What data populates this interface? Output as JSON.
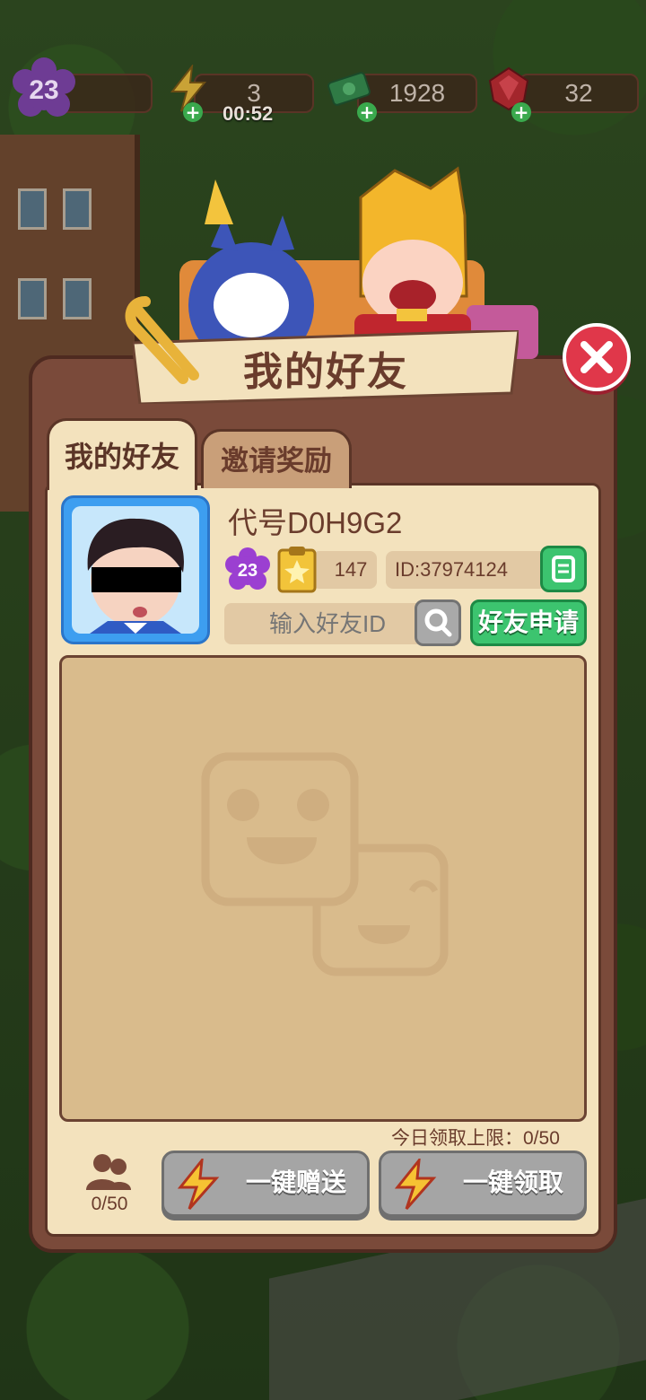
{
  "topbar": {
    "level": "23",
    "energy": "3",
    "energy_timer": "00:52",
    "cash": "1928",
    "gems": "32"
  },
  "dialog": {
    "title": "我的好友",
    "tabs": [
      {
        "label": "我的好友",
        "active": true
      },
      {
        "label": "邀请奖励",
        "active": false
      }
    ],
    "profile": {
      "nickname": "代号D0H9G2",
      "level": "23",
      "stars": "147",
      "id": "ID:37974124"
    },
    "search": {
      "placeholder": "输入好友ID",
      "apply_label": "好友申请"
    },
    "daily_limit": "今日领取上限：0/50",
    "friend_count": "0/50",
    "buttons": {
      "send_all": "一键赠送",
      "claim_all": "一键领取"
    }
  },
  "colors": {
    "dialog_frame": "#7a4a3a",
    "panel": "#f3e2bd",
    "accent_green": "#3cc46f",
    "close_red": "#e0374a",
    "disabled_gray": "#a5a5a5",
    "text_brown": "#6a3c2c"
  },
  "icons": [
    "level-badge-icon",
    "lightning-icon",
    "cash-icon",
    "gem-icon",
    "close-icon",
    "star-clipboard-icon",
    "copy-icon",
    "search-icon",
    "friends-icon"
  ]
}
